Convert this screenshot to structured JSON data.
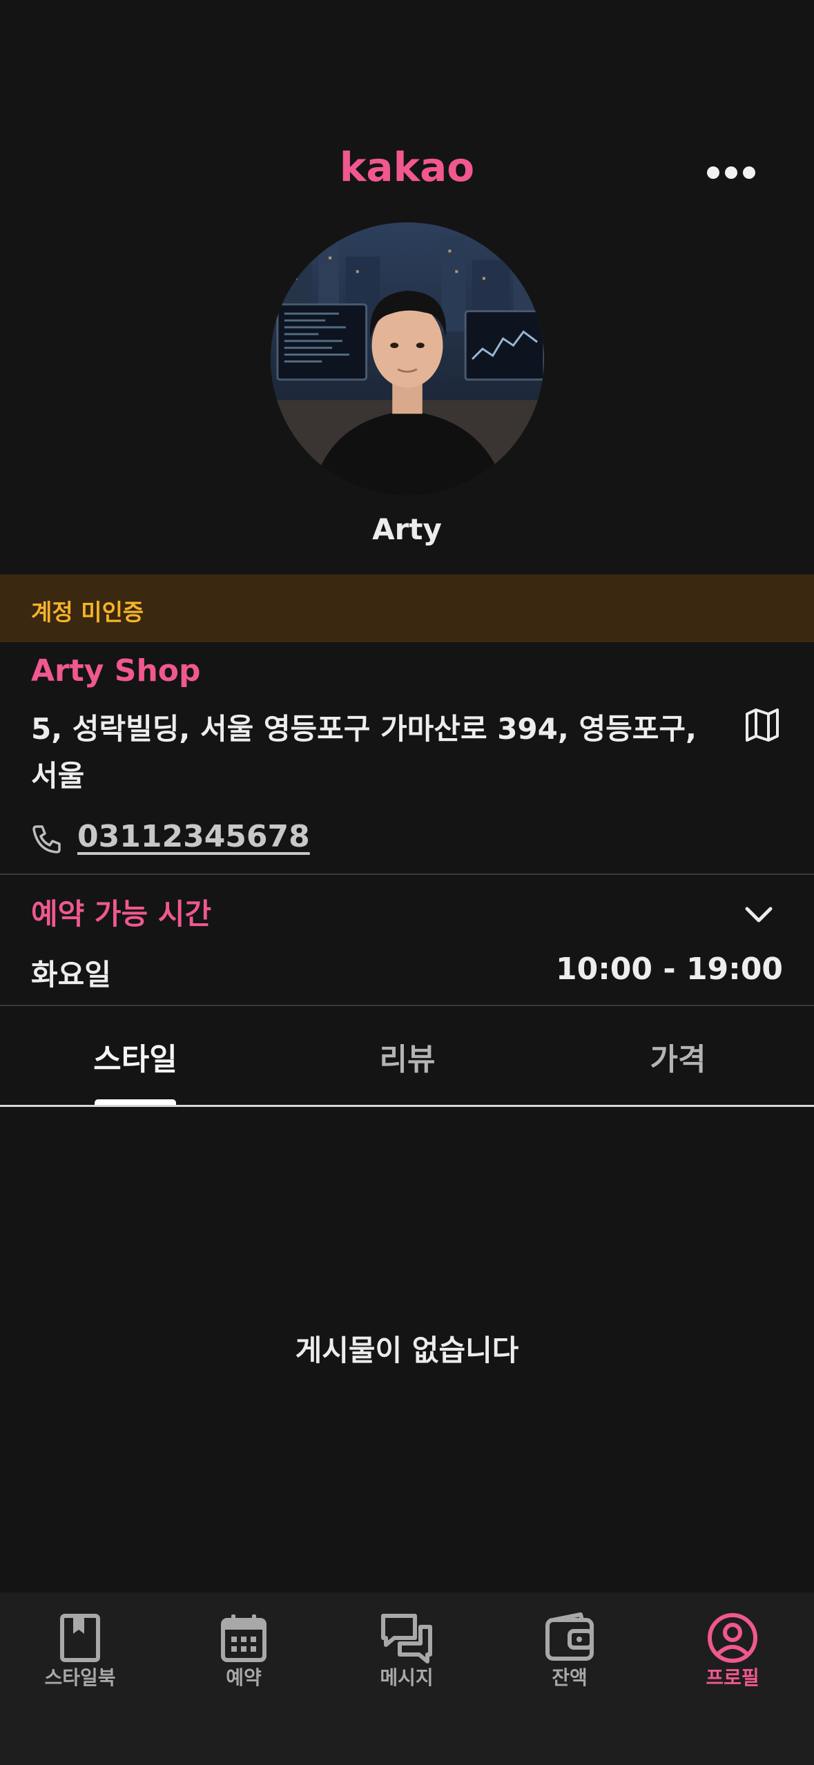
{
  "header": {
    "brand": "kakao",
    "more_icon": "more-horizontal-icon"
  },
  "profile": {
    "name": "Arty",
    "avatar_icon": "profile-photo"
  },
  "verification_banner": {
    "text": "계정 미인증",
    "color": "#f5b32a",
    "background": "#3a2810"
  },
  "shop": {
    "name": "Arty Shop",
    "address": "5, 성락빌딩, 서울 영등포구 가마산로 394, 영등포구, 서울",
    "map_icon": "map-icon",
    "phone_icon": "phone-icon",
    "phone": "03112345678"
  },
  "hours": {
    "title": "예약 가능 시간",
    "toggle_icon": "chevron-down-icon",
    "day": "화요일",
    "time": "10:00 - 19:00"
  },
  "tabs": [
    {
      "label": "스타일",
      "active": true
    },
    {
      "label": "리뷰",
      "active": false
    },
    {
      "label": "가격",
      "active": false
    }
  ],
  "empty_state": {
    "text": "게시물이 없습니다"
  },
  "bottom_nav": [
    {
      "label": "스타일북",
      "icon": "bookmark-book-icon",
      "active": false
    },
    {
      "label": "예약",
      "icon": "calendar-icon",
      "active": false
    },
    {
      "label": "메시지",
      "icon": "chat-bubbles-icon",
      "active": false
    },
    {
      "label": "잔액",
      "icon": "wallet-icon",
      "active": false
    },
    {
      "label": "프로필",
      "icon": "user-circle-icon",
      "active": true
    }
  ],
  "colors": {
    "accent": "#f0588f",
    "background": "#141414",
    "nav_background": "#1e1e1e"
  }
}
